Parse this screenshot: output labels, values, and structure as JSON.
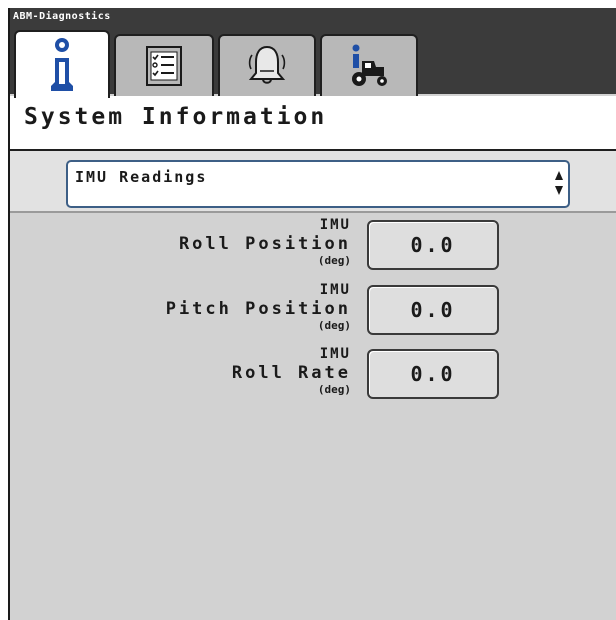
{
  "app": {
    "title": "ABM-Diagnostics"
  },
  "tabs": [
    {
      "icon": "info-icon",
      "active": true
    },
    {
      "icon": "checklist-icon",
      "active": false
    },
    {
      "icon": "alarm-bell-icon",
      "active": false
    },
    {
      "icon": "tractor-info-icon",
      "active": false
    }
  ],
  "page": {
    "title": "System Information"
  },
  "selector": {
    "value": "IMU Readings"
  },
  "readings": [
    {
      "prefix": "IMU",
      "label": "Roll Position",
      "unit": "(deg)",
      "value": "0.0"
    },
    {
      "prefix": "IMU",
      "label": "Pitch Position",
      "unit": "(deg)",
      "value": "0.0"
    },
    {
      "prefix": "IMU",
      "label": "Roll Rate",
      "unit": "(deg)",
      "value": "0.0"
    }
  ],
  "colors": {
    "titlebar": "#3b3b3b",
    "background": "#d2d2d2",
    "accent_border": "#3d5f86",
    "info_blue": "#1f4fa6"
  }
}
